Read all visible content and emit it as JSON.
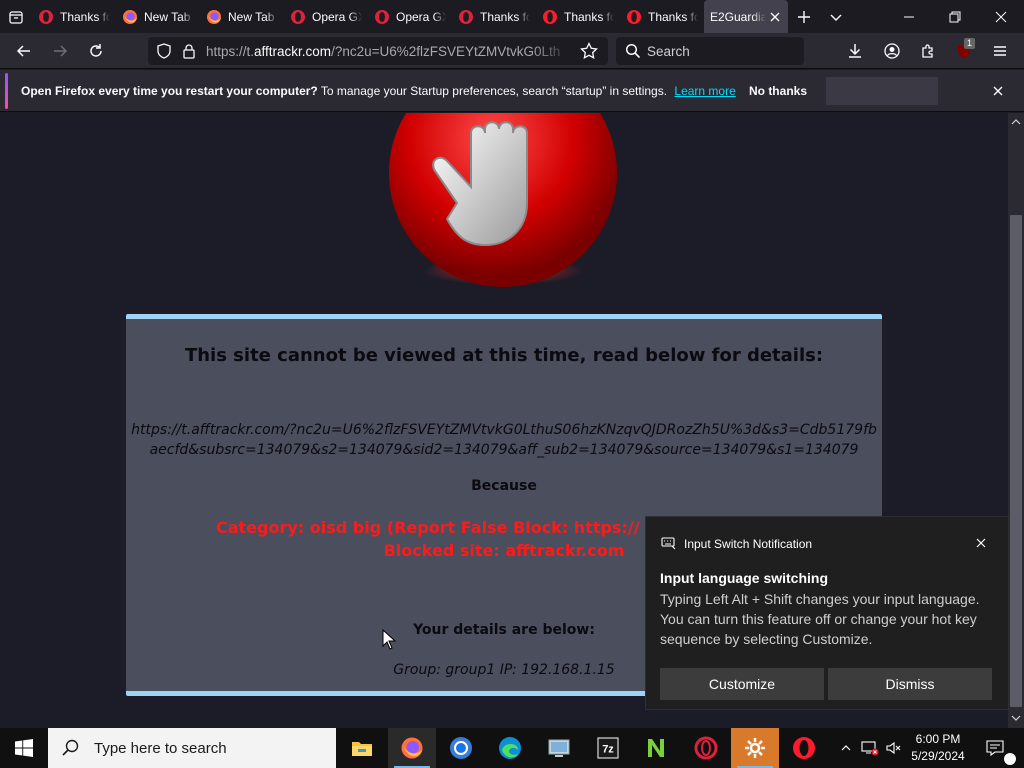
{
  "tabs": [
    {
      "title": "Thanks for",
      "icon": "opera-gx-icon"
    },
    {
      "title": "New Tab",
      "icon": "firefox-icon"
    },
    {
      "title": "New Tab",
      "icon": "firefox-icon"
    },
    {
      "title": "Opera GX",
      "icon": "opera-gx-icon"
    },
    {
      "title": "Opera GX",
      "icon": "opera-gx-icon"
    },
    {
      "title": "Thanks for",
      "icon": "opera-gx-icon"
    },
    {
      "title": "Thanks for",
      "icon": "opera-icon"
    },
    {
      "title": "Thanks for",
      "icon": "opera-icon"
    },
    {
      "title": "E2Guardian",
      "icon": "none"
    }
  ],
  "nav": {
    "url_prefix": "https://t.",
    "url_host": "afftrackr.com",
    "url_rest": "/?nc2u=U6%2flzFSVEYtZMVtvkG0Lth",
    "search_placeholder": "Search",
    "extension_badge": "1"
  },
  "infobar": {
    "bold": "Open Firefox every time you restart your computer?",
    "text": " To manage your Startup preferences, search “startup” in settings.",
    "learn_more": "Learn more",
    "no_thanks": "No thanks"
  },
  "block_page": {
    "title": "This site cannot be viewed at this time, read below for details:",
    "url": "https://t.afftrackr.com/?nc2u=U6%2flzFSVEYtZMVtvkG0LthuS06hzKNzqvQJDRozZh5U%3d&s3=Cdb5179fbaecfd&subsrc=134079&s2=134079&sid2=134079&aff_sub2=134079&source=134079&s1=134079",
    "because": "Because",
    "category": "Category: oisd big (Report False Block: https://",
    "blocked_site": "Blocked site: afftrackr.com",
    "details_heading": "Your details are below:",
    "group_line": "Group: group1   IP: 192.168.1.15"
  },
  "notification": {
    "header": "Input Switch Notification",
    "title": "Input language switching",
    "body": "Typing Left Alt + Shift changes your input language. You can turn this feature off or change your hot key sequence by selecting Customize.",
    "customize": "Customize",
    "dismiss": "Dismiss"
  },
  "taskbar": {
    "search_placeholder": "Type here to search",
    "time": "6:00 PM",
    "date": "5/29/2024",
    "apps": [
      "file-explorer-icon",
      "firefox-icon",
      "chrome-icon",
      "edge-icon",
      "control-panel-icon",
      "7zip-icon",
      "notepad-plus-plus-icon",
      "opera-gx-icon",
      "settings-icon",
      "opera-icon"
    ]
  },
  "colors": {
    "panel_bg": "#4b4e5d",
    "panel_border": "#9fd2f4",
    "blocked_red": "#ff1a1a",
    "firefox_toolbar": "#2b2a33"
  }
}
